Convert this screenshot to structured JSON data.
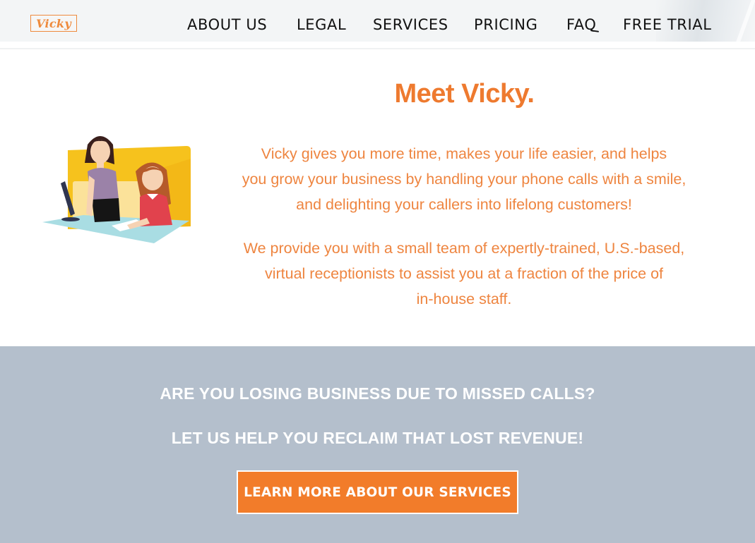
{
  "header": {
    "logo_text": "Vicky",
    "nav": [
      {
        "label": "ABOUT US"
      },
      {
        "label": "LEGAL"
      },
      {
        "label": "SERVICES"
      },
      {
        "label": "PRICING"
      },
      {
        "label": "FAQ"
      },
      {
        "label": "FREE TRIAL"
      }
    ]
  },
  "intro": {
    "title": "Meet Vicky.",
    "paragraph1": [
      "Vicky gives you more time, makes your life easier, and helps",
      "you grow your business by handling your phone calls with a smile,",
      "and delighting your callers into lifelong customers!"
    ],
    "paragraph2": [
      "We provide you with a small team of expertly-trained, U.S.-based,",
      "virtual receptionists to assist you at a fraction of the price of",
      "in-house staff."
    ],
    "illustration": "receptionists-at-desk-illustration"
  },
  "cta_band": {
    "line1": "ARE YOU LOSING BUSINESS DUE TO MISSED CALLS?",
    "line2": "LET US HELP YOU RECLAIM THAT LOST REVENUE!",
    "button_label": "LEARN MORE ABOUT OUR SERVICES"
  },
  "colors": {
    "brand_orange": "#ee7a2f",
    "button_orange": "#f27c2a",
    "band_gray": "#b4bfcc",
    "header_bg": "#f3f5f6"
  }
}
